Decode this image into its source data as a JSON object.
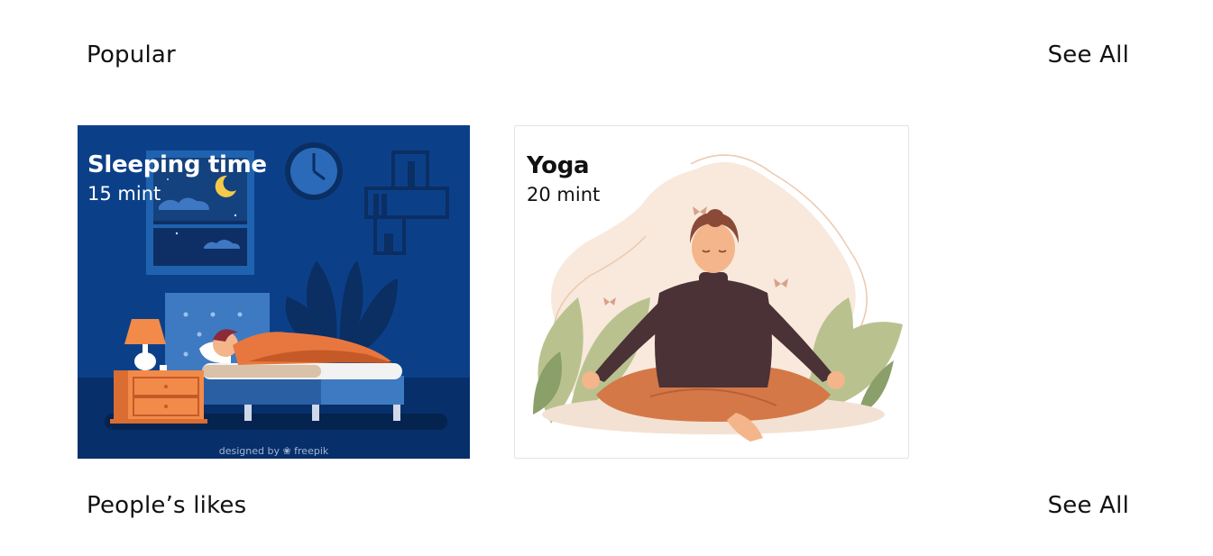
{
  "sections": {
    "popular": {
      "title": "Popular",
      "see_all_label": "See All"
    },
    "peoples_likes": {
      "title": "People’s likes",
      "see_all_label": "See All"
    }
  },
  "cards": [
    {
      "title": "Sleeping time",
      "duration": "15 mint",
      "illustration": "sleeping-bedroom-illustration",
      "credit": "designed by ❀ freepik",
      "background_color": "#0a3f87"
    },
    {
      "title": "Yoga",
      "duration": "20 mint",
      "illustration": "yoga-meditation-illustration",
      "background_color": "#ffffff"
    }
  ]
}
